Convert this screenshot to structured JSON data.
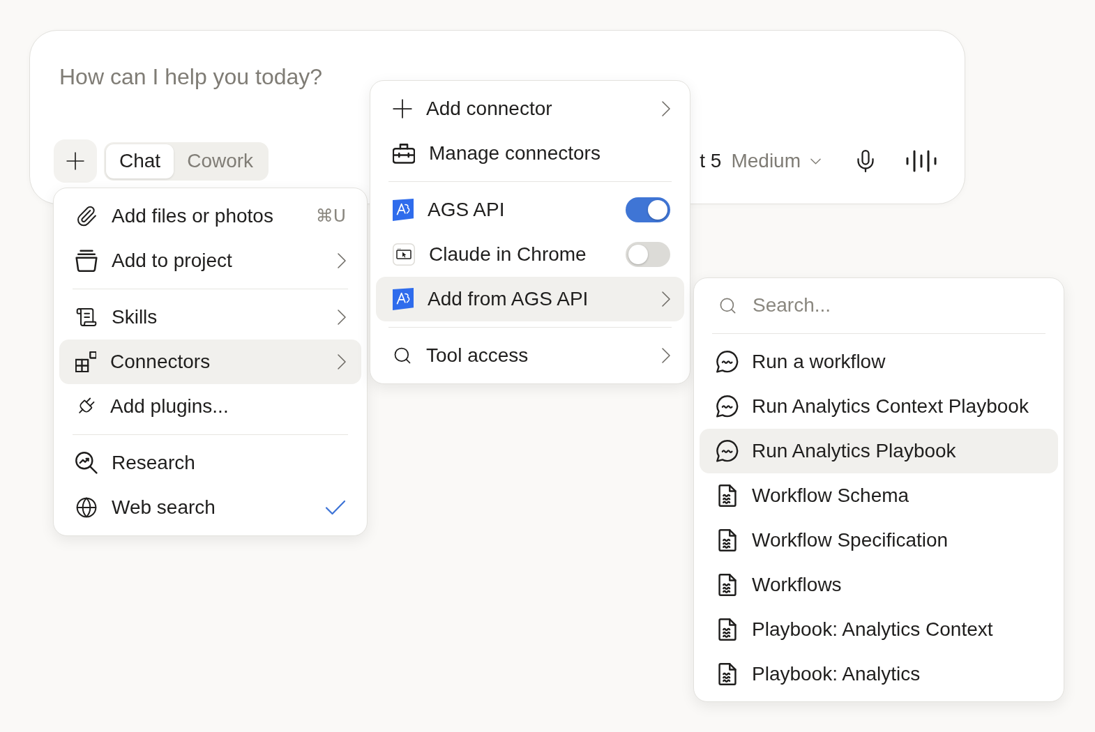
{
  "composer": {
    "placeholder": "How can I help you today?",
    "modes": [
      {
        "label": "Chat",
        "selected": true
      },
      {
        "label": "Cowork",
        "selected": false
      }
    ],
    "model": {
      "name": "t 5",
      "effort": "Medium"
    }
  },
  "attach_menu": {
    "sections": [
      {
        "items": [
          {
            "label": "Add files or photos",
            "kind": "shortcut",
            "shortcut": "⌘U",
            "highlighted": false
          },
          {
            "label": "Add to project",
            "kind": "submenu",
            "highlighted": false
          }
        ]
      },
      {
        "items": [
          {
            "label": "Skills",
            "kind": "submenu",
            "highlighted": false
          },
          {
            "label": "Connectors",
            "kind": "submenu",
            "highlighted": true
          },
          {
            "label": "Add plugins...",
            "kind": "plain",
            "highlighted": false
          }
        ]
      },
      {
        "items": [
          {
            "label": "Research",
            "kind": "plain",
            "highlighted": false
          },
          {
            "label": "Web search",
            "kind": "check",
            "checked": true,
            "highlighted": false
          }
        ]
      }
    ]
  },
  "connectors_menu": {
    "sections": [
      {
        "items": [
          {
            "label": "Add connector",
            "kind": "submenu",
            "highlighted": false
          },
          {
            "label": "Manage connectors",
            "kind": "plain",
            "highlighted": false
          }
        ]
      },
      {
        "items": [
          {
            "label": "AGS API",
            "kind": "toggle",
            "on": true,
            "highlighted": false
          },
          {
            "label": "Claude in Chrome",
            "kind": "toggle",
            "on": false,
            "highlighted": false
          },
          {
            "label": "Add from AGS API",
            "kind": "submenu",
            "highlighted": true
          }
        ]
      },
      {
        "items": [
          {
            "label": "Tool access",
            "kind": "submenu",
            "highlighted": false
          }
        ]
      }
    ]
  },
  "ags_submenu": {
    "search": {
      "placeholder": "Search..."
    },
    "items": [
      {
        "label": "Run a workflow",
        "kind": "prompt",
        "highlighted": false
      },
      {
        "label": "Run Analytics Context Playbook",
        "kind": "prompt",
        "highlighted": false
      },
      {
        "label": "Run Analytics Playbook",
        "kind": "prompt",
        "highlighted": true
      },
      {
        "label": "Workflow Schema",
        "kind": "document",
        "highlighted": false
      },
      {
        "label": "Workflow Specification",
        "kind": "document",
        "highlighted": false
      },
      {
        "label": "Workflows",
        "kind": "document",
        "highlighted": false
      },
      {
        "label": "Playbook: Analytics Context",
        "kind": "document",
        "highlighted": false
      },
      {
        "label": "Playbook: Analytics",
        "kind": "document",
        "highlighted": false
      }
    ]
  }
}
